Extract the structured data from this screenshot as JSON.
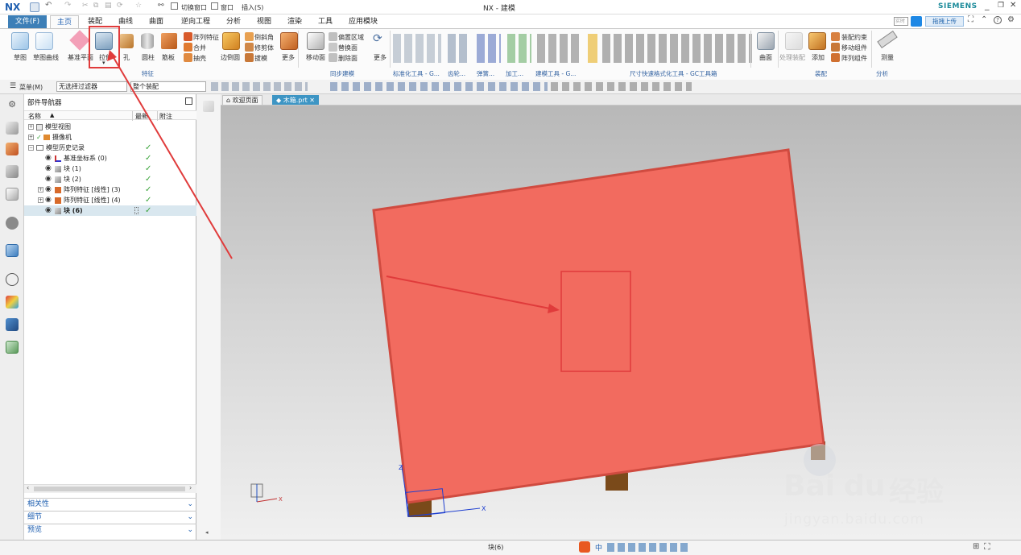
{
  "app": {
    "logo": "NX",
    "title": "NX - 建模",
    "brand": "SIEMENS",
    "search_placeholder": "实时",
    "upload_label": "拖拽上传"
  },
  "quick_access": {
    "switch_window": "切换窗口",
    "window": "窗口",
    "insert": "插入(S)"
  },
  "menu_tabs": [
    "文件(F)",
    "主页",
    "装配",
    "曲线",
    "曲面",
    "逆向工程",
    "分析",
    "视图",
    "渲染",
    "工具",
    "应用模块"
  ],
  "active_tab": "主页",
  "ribbon": {
    "sketch": "草图",
    "sketch_curve": "草图曲线",
    "datum_plane": "基准平面",
    "extrude": "拉伸",
    "hole": "孔",
    "cylinder": "圆柱",
    "rib": "筋板",
    "pattern_feature": "阵列特征",
    "unite": "合并",
    "shell": "抽壳",
    "edge_blend": "边倒圆",
    "chamfer": "倒斜角",
    "trim_body": "修剪体",
    "draft": "拔模",
    "more1": "更多",
    "move_face": "移动面",
    "offset_region": "偏置区域",
    "replace_face": "替换面",
    "delete_face": "删除面",
    "more2": "更多",
    "surface": "曲面",
    "make_unique": "处理装配",
    "add": "添加",
    "assembly_constraint": "装配约束",
    "move_component": "移动组件",
    "pattern_component": "阵列组件",
    "measure": "测量"
  },
  "ribbon_groups": [
    "特征",
    "同步建模",
    "标准化工具 - G...",
    "齿轮...",
    "弹簧...",
    "加工...",
    "建模工具 - G...",
    "尺寸快速格式化工具 - GC工具箱",
    "装配",
    "分析"
  ],
  "toolbar": {
    "menu": "菜单(M)",
    "filter": "无选择过滤器",
    "scope": "整个装配"
  },
  "navigator": {
    "title": "部件导航器",
    "col_name": "名称",
    "col_latest": "最新",
    "col_note": "附注",
    "rows": [
      {
        "label": "模型视图",
        "check": ""
      },
      {
        "label": "摄像机",
        "check": ""
      },
      {
        "label": "模型历史记录",
        "check": "✓"
      },
      {
        "label": "基准坐标系 (0)",
        "check": "✓"
      },
      {
        "label": "块 (1)",
        "check": "✓"
      },
      {
        "label": "块 (2)",
        "check": "✓"
      },
      {
        "label": "阵列特征 [线性] (3)",
        "check": "✓"
      },
      {
        "label": "阵列特征 [线性] (4)",
        "check": "✓"
      },
      {
        "label": "块 (6)",
        "check": "✓"
      }
    ],
    "panels": [
      "相关性",
      "细节",
      "预览"
    ]
  },
  "doc_tabs": [
    "欢迎页面",
    "木箱.prt"
  ],
  "status": {
    "selection": "块(6)",
    "ime": "中"
  },
  "watermark": {
    "brand": "Bai",
    "brand2": "du",
    "cn": "经验",
    "url": "jingyan.baidu.com"
  },
  "colors": {
    "accent": "#1f5fb0",
    "tab_active": "#3d95c4",
    "part_face": "#f26b5f",
    "annotation": "#e03b3b",
    "foot": "#7a4a1a"
  }
}
